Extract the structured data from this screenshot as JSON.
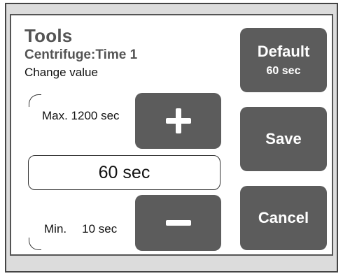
{
  "header": {
    "title": "Tools",
    "subtitle": "Centrifuge:Time 1",
    "hint": "Change value"
  },
  "range": {
    "max_label": "Max. 1200 sec",
    "min_prefix": "Min.",
    "min_value": "10 sec"
  },
  "value_field": {
    "value": "60 sec"
  },
  "buttons": {
    "default_label": "Default",
    "default_value": "60 sec",
    "save_label": "Save",
    "cancel_label": "Cancel"
  },
  "icons": {
    "increment": "plus-icon",
    "decrement": "minus-icon"
  },
  "colors": {
    "button_fill": "#5c5c5c",
    "header_text": "#545454",
    "frame_bg": "#dcdcdc"
  }
}
